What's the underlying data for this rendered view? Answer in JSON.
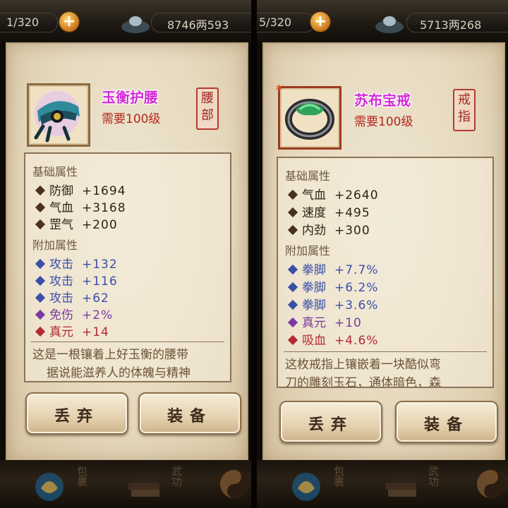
{
  "panels": [
    {
      "topbar": {
        "counter": "1/320",
        "currency": "8746两593"
      },
      "item": {
        "name": "玉衡护腰",
        "requirement": "需要100级",
        "slot": "腰部",
        "icon": "jade-belt-icon",
        "base_title": "基础属性",
        "base_stats": [
          {
            "name": "防御",
            "value": "+1694"
          },
          {
            "name": "气血",
            "value": "+3168"
          },
          {
            "name": "罡气",
            "value": "+200"
          }
        ],
        "extra_title": "附加属性",
        "extra_stats": [
          {
            "name": "攻击",
            "value": "+132",
            "color": "#3a4fa8"
          },
          {
            "name": "攻击",
            "value": "+116",
            "color": "#3a4fa8"
          },
          {
            "name": "攻击",
            "value": "+62",
            "color": "#3a4fa8"
          },
          {
            "name": "免伤",
            "value": "+2%",
            "color": "#7b3aa0"
          },
          {
            "name": "真元",
            "value": "+14",
            "color": "#b32a35"
          }
        ],
        "desc_line1": "这是一根镶着上好玉衡的腰带",
        "desc_line2": "据说能滋养人的体魄与精神"
      },
      "buttons": {
        "discard": "丢弃",
        "equip": "装备"
      },
      "bottom": {
        "bag": "包裹",
        "skill": "武功"
      }
    },
    {
      "topbar": {
        "counter": "5/320",
        "currency": "5713两268"
      },
      "item": {
        "name": "苏布宝戒",
        "requirement": "需要100级",
        "slot": "戒指",
        "icon": "jade-ring-icon",
        "base_title": "基础属性",
        "base_stats": [
          {
            "name": "气血",
            "value": "+2640"
          },
          {
            "name": "速度",
            "value": "+495"
          },
          {
            "name": "内劲",
            "value": "+300"
          }
        ],
        "extra_title": "附加属性",
        "extra_stats": [
          {
            "name": "拳脚",
            "value": "+7.7%",
            "color": "#3a4fa8"
          },
          {
            "name": "拳脚",
            "value": "+6.2%",
            "color": "#3a4fa8"
          },
          {
            "name": "拳脚",
            "value": "+3.6%",
            "color": "#3a4fa8"
          },
          {
            "name": "真元",
            "value": "+10",
            "color": "#7b3aa0"
          },
          {
            "name": "吸血",
            "value": "+4.6%",
            "color": "#b32a35"
          }
        ],
        "desc_line1": "这枚戒指上镶嵌着一块酷似弯",
        "desc_line2": "刀的雕刻玉石，通体暗色，森"
      },
      "buttons": {
        "discard": "丢弃",
        "equip": "装备"
      },
      "bottom": {
        "bag": "包裹",
        "skill": "武功"
      }
    }
  ],
  "colors": {
    "base_diamond": "#4a3020",
    "extra_blue": "#3a4fa8",
    "extra_purple": "#7b3aa0",
    "extra_red": "#b32a35",
    "item_name": "#d22ad8",
    "requirement": "#b3261e"
  }
}
